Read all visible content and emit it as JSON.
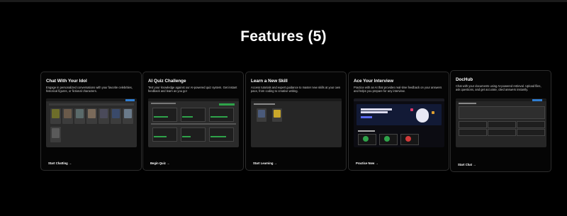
{
  "section": {
    "title": "Features (5)"
  },
  "cards": [
    {
      "title": "Chat With Your Idol",
      "description": "Engage in personalized conversations with your favorite celebrities, historical figures, or fictional characters.",
      "cta": "Start Chatting →"
    },
    {
      "title": "AI Quiz Challenge",
      "description": "Test your knowledge against our AI-powered quiz system. Get instant feedback and learn as you go!",
      "cta": "Begin Quiz →"
    },
    {
      "title": "Learn a New Skill",
      "description": "Access tutorials and expert guidance to master new skills at your own pace, from coding to creative writing.",
      "cta": "Start Learning →"
    },
    {
      "title": "Ace Your Interview",
      "description": "Practice with an AI that provides real-time feedback on your answers and helps you prepare for any interview.",
      "cta": "Practice Now →"
    },
    {
      "title": "DocHub",
      "description": "Chat with your documents using AI-powered retrieval. Upload files, ask questions, and get accurate, cited answers instantly.",
      "cta": "Start Chat →"
    }
  ],
  "colors": {
    "background": "#000000",
    "card_border": "#2d2d2d",
    "accent": "#2f7dd1"
  }
}
